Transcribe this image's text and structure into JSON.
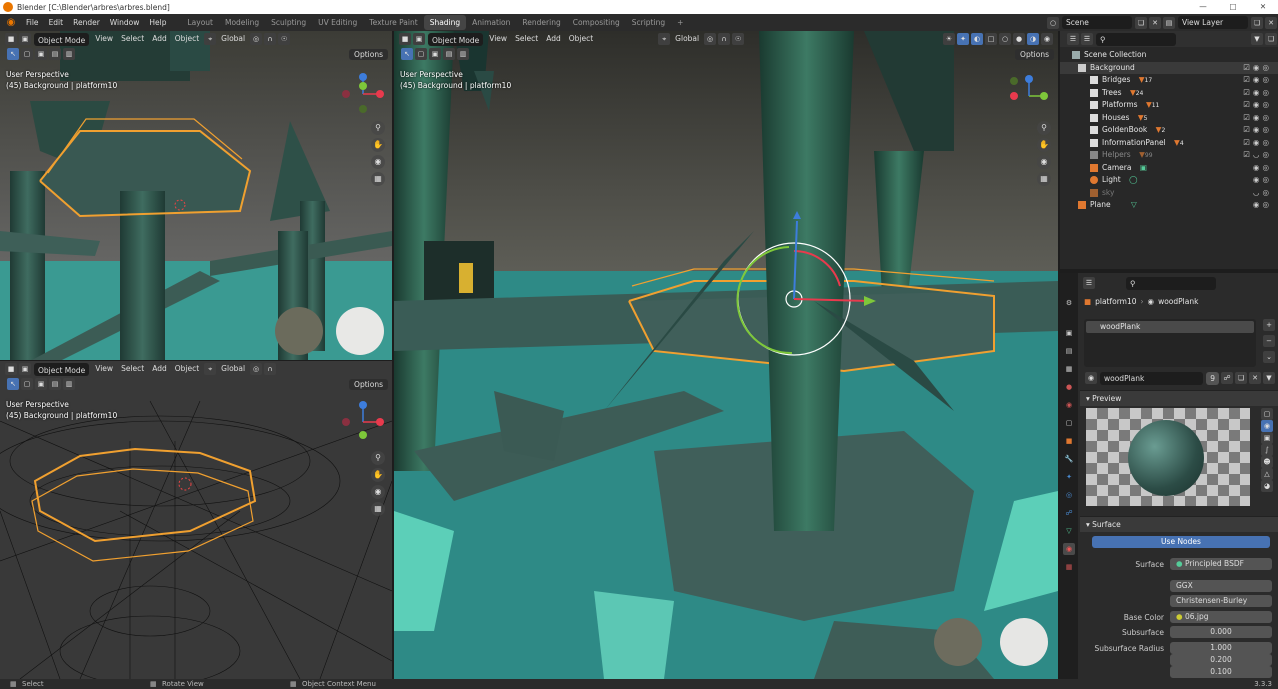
{
  "window": {
    "title": "Blender [C:\\Blender\\arbres\\arbres.blend]"
  },
  "menu": {
    "items": [
      "File",
      "Edit",
      "Render",
      "Window",
      "Help"
    ]
  },
  "workspaces": [
    "Layout",
    "Modeling",
    "Sculpting",
    "UV Editing",
    "Texture Paint",
    "Shading",
    "Animation",
    "Rendering",
    "Compositing",
    "Scripting"
  ],
  "active_workspace": "Shading",
  "scene": {
    "name": "Scene",
    "view_layer": "View Layer"
  },
  "viewport_header": {
    "mode": "Object Mode",
    "view": "View",
    "select": "Select",
    "add": "Add",
    "object": "Object",
    "orientation": "Global",
    "options": "Options"
  },
  "viewport": {
    "perspective": "User Perspective",
    "context": "(45) Background | platform10"
  },
  "outliner": {
    "root": "Scene Collection",
    "collections": [
      {
        "name": "Background"
      },
      {
        "name": "Bridges",
        "count": "17"
      },
      {
        "name": "Trees",
        "count": "24"
      },
      {
        "name": "Platforms",
        "count": "11"
      },
      {
        "name": "Houses",
        "count": "5"
      },
      {
        "name": "GoldenBook",
        "count": "2"
      },
      {
        "name": "InformationPanel",
        "count": "4"
      },
      {
        "name": "Helpers",
        "count": "99"
      },
      {
        "name": "Camera"
      },
      {
        "name": "Light"
      },
      {
        "name": "sky"
      },
      {
        "name": "Plane"
      }
    ]
  },
  "properties": {
    "breadcrumb_object": "platform10",
    "breadcrumb_material": "woodPlank",
    "slot": "woodPlank",
    "material_name": "woodPlank",
    "users": "9",
    "preview_label": "Preview",
    "surface_label": "Surface",
    "use_nodes": "Use Nodes",
    "rows": [
      {
        "label": "Surface",
        "value": "Principled BSDF"
      },
      {
        "label": "",
        "value": "GGX"
      },
      {
        "label": "",
        "value": "Christensen-Burley"
      },
      {
        "label": "Base Color",
        "value": "06.jpg"
      },
      {
        "label": "Subsurface",
        "value": "0.000"
      },
      {
        "label": "Subsurface Radius",
        "value": "1.000"
      },
      {
        "label": "",
        "value": "0.200"
      },
      {
        "label": "",
        "value": "0.100"
      }
    ]
  },
  "status": {
    "select": "Select",
    "rotate": "Rotate View",
    "context": "Object Context Menu",
    "version": "3.3.3"
  },
  "colors": {
    "accent": "#4772b3",
    "selection": "#f0a030",
    "blender_orange": "#ea7600",
    "gizmo_x": "#e83a4d",
    "gizmo_y": "#7ec83a",
    "gizmo_z": "#3d7ddc"
  }
}
